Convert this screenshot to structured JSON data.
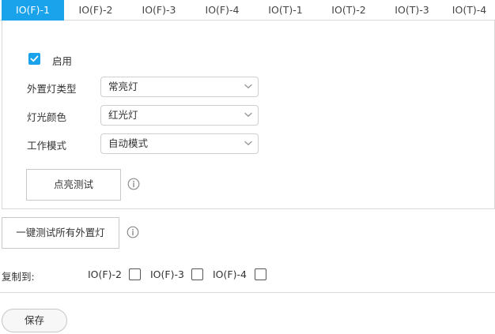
{
  "tabs": [
    {
      "label": "IO(F)-1",
      "active": true
    },
    {
      "label": "IO(F)-2",
      "active": false
    },
    {
      "label": "IO(F)-3",
      "active": false
    },
    {
      "label": "IO(F)-4",
      "active": false
    },
    {
      "label": "IO(T)-1",
      "active": false
    },
    {
      "label": "IO(T)-2",
      "active": false
    },
    {
      "label": "IO(T)-3",
      "active": false
    },
    {
      "label": "IO(T)-4",
      "active": false
    }
  ],
  "panel": {
    "enable": {
      "label": "启用",
      "checked": true
    },
    "fields": [
      {
        "label": "外置灯类型",
        "value": "常亮灯"
      },
      {
        "label": "灯光颜色",
        "value": "红光灯"
      },
      {
        "label": "工作模式",
        "value": "自动模式"
      }
    ],
    "test_button": "点亮测试"
  },
  "test_all_button": "一键测试所有外置灯",
  "copy_to": {
    "label": "复制到:",
    "targets": [
      {
        "label": "IO(F)-2",
        "checked": false
      },
      {
        "label": "IO(F)-3",
        "checked": false
      },
      {
        "label": "IO(F)-4",
        "checked": false
      }
    ]
  },
  "save_button": "保存",
  "colors": {
    "accent": "#1aa3ea",
    "border": "#d9d9d9",
    "info_icon": "#8c8c8c"
  },
  "icons": {
    "checkbox_checked": "check-icon",
    "select_arrow": "chevron-down-icon",
    "info": "info-circle-icon"
  }
}
